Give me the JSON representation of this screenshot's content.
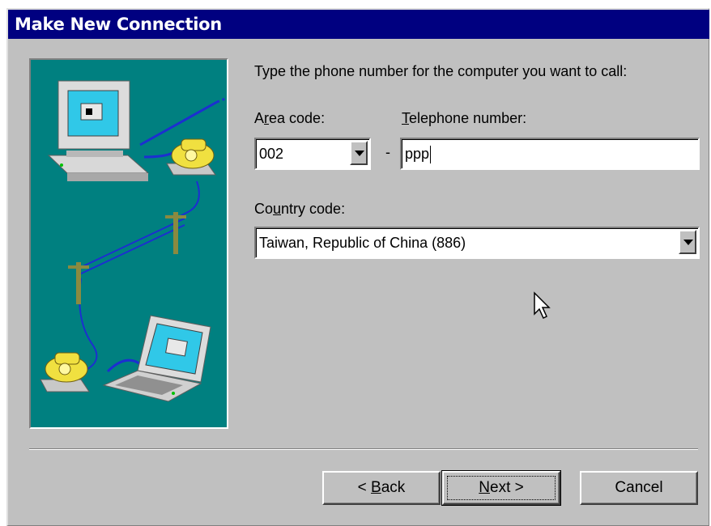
{
  "window": {
    "title": "Make New Connection"
  },
  "instructions": "Type the phone number for the computer you want to call:",
  "area_code": {
    "label_before": "A",
    "label_mnemonic": "r",
    "label_after": "ea code:",
    "value": "002"
  },
  "separator_dash": "-",
  "telephone": {
    "label_mnemonic": "T",
    "label_after": "elephone number:",
    "value": "ppp"
  },
  "country_code": {
    "label_before": "Co",
    "label_mnemonic": "u",
    "label_after": "ntry code:",
    "value": "Taiwan, Republic of China (886)"
  },
  "buttons": {
    "back": {
      "prefix": "< ",
      "mnemonic": "B",
      "rest": "ack"
    },
    "next": {
      "mnemonic": "N",
      "rest": "ext >"
    },
    "cancel": "Cancel"
  },
  "colors": {
    "titlebar": "#000080",
    "dialog_bg": "#c0c0c0",
    "illustration_bg": "#008080"
  }
}
